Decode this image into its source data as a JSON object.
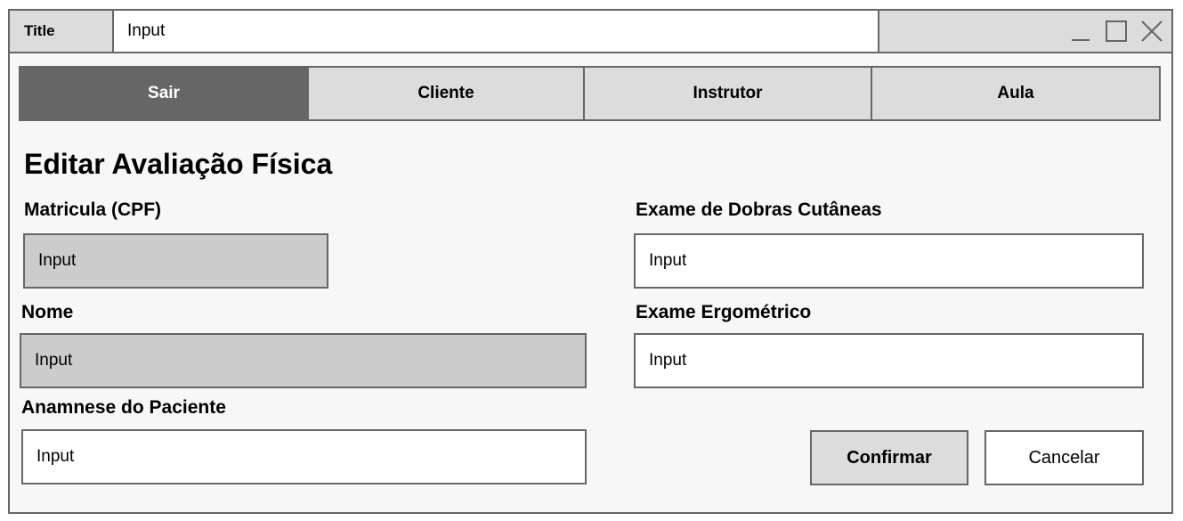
{
  "window": {
    "title_label": "Title",
    "title_input": "Input",
    "controls": [
      "minimize-icon",
      "maximize-icon",
      "close-icon"
    ]
  },
  "tabs": [
    {
      "label": "Sair",
      "active": true
    },
    {
      "label": "Cliente",
      "active": false
    },
    {
      "label": "Instrutor",
      "active": false
    },
    {
      "label": "Aula",
      "active": false
    }
  ],
  "page": {
    "heading": "Editar Avaliação Física"
  },
  "form": {
    "matricula": {
      "label": "Matricula (CPF)",
      "value": "Input"
    },
    "nome": {
      "label": "Nome",
      "value": "Input"
    },
    "anamnese": {
      "label": "Anamnese do Paciente",
      "value": "Input"
    },
    "dobras": {
      "label": "Exame de Dobras Cutâneas",
      "value": "Input"
    },
    "ergometrico": {
      "label": "Exame Ergométrico",
      "value": "Input"
    }
  },
  "actions": {
    "confirm_label": "Confirmar",
    "cancel_label": "Cancelar"
  },
  "colors": {
    "border": "#666666",
    "active_tab": "#666666",
    "disabled_field": "#cccccc",
    "panel": "#dcdcdc"
  }
}
